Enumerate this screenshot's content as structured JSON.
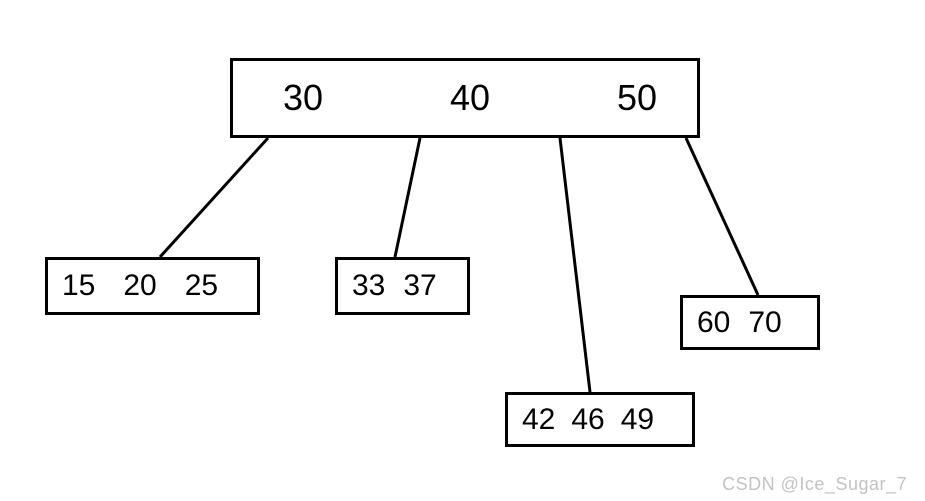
{
  "tree": {
    "root": {
      "keys": [
        "30",
        "40",
        "50"
      ]
    },
    "children": [
      {
        "keys": [
          "15",
          "20",
          "25"
        ]
      },
      {
        "keys": [
          "33",
          "37"
        ]
      },
      {
        "keys": [
          "42",
          "46",
          "49"
        ]
      },
      {
        "keys": [
          "60",
          "70"
        ]
      }
    ]
  },
  "watermark": "CSDN @Ice_Sugar_7"
}
